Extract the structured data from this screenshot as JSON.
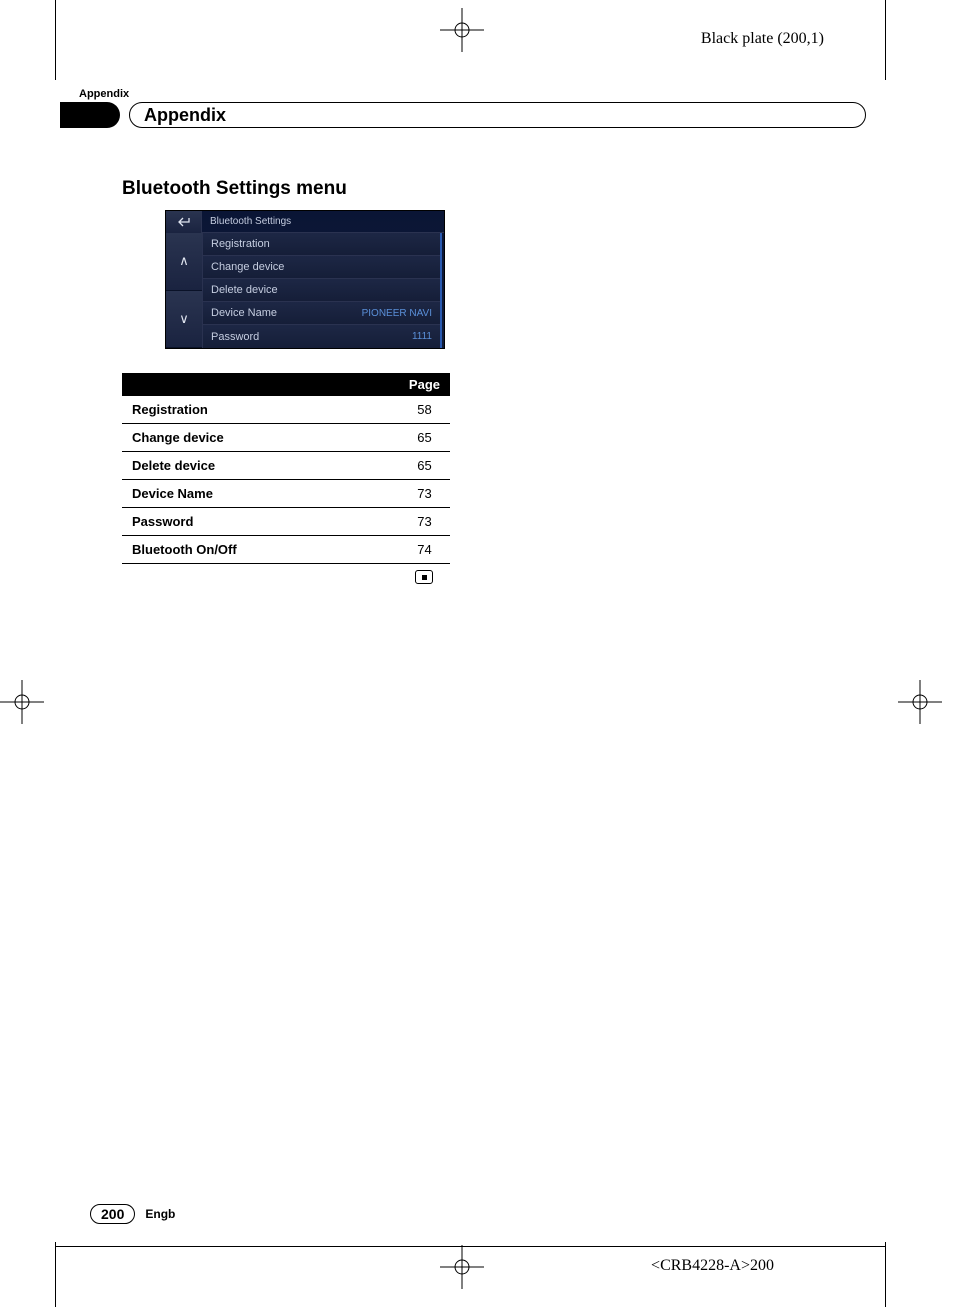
{
  "plate_label": "Black plate (200,1)",
  "appendix_small": "Appendix",
  "section_title": "Appendix",
  "menu_heading": "Bluetooth Settings menu",
  "screenshot": {
    "title": "Bluetooth Settings",
    "rows": [
      {
        "label": "Registration",
        "value": ""
      },
      {
        "label": "Change device",
        "value": ""
      },
      {
        "label": "Delete device",
        "value": ""
      },
      {
        "label": "Device Name",
        "value": "PIONEER NAVI"
      },
      {
        "label": "Password",
        "value": "1111"
      }
    ]
  },
  "index_table": {
    "header_page": "Page",
    "rows": [
      {
        "name": "Registration",
        "page": "58"
      },
      {
        "name": "Change device",
        "page": "65"
      },
      {
        "name": "Delete device",
        "page": "65"
      },
      {
        "name": "Device Name",
        "page": "73"
      },
      {
        "name": "Password",
        "page": "73"
      },
      {
        "name": "Bluetooth On/Off",
        "page": "74"
      }
    ]
  },
  "footer": {
    "page_number": "200",
    "language": "Engb"
  },
  "doc_code": "<CRB4228-A>200"
}
